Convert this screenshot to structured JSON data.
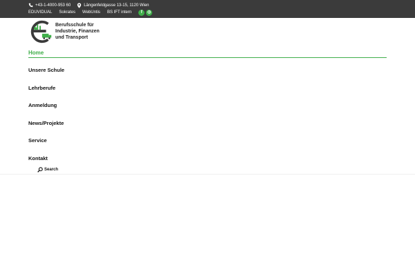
{
  "topbar": {
    "phone": "+43-1-4000-953 60",
    "address": "Längenfeldgasse 13-15, 1120 Wien",
    "links": [
      "EDUVIDUAL",
      "Sokrates",
      "WebUntis",
      "BS IFT intern"
    ],
    "social": [
      {
        "icon": "facebook-icon",
        "glyph": "f"
      },
      {
        "icon": "instagram-icon",
        "glyph": "◎"
      }
    ]
  },
  "brand": {
    "line1": "Berufsschule für",
    "line2": "Industrie, Finanzen",
    "line3": "und Transport"
  },
  "nav": {
    "home": "Home",
    "items": [
      "Unsere Schule",
      "Lehrberufe",
      "Anmeldung",
      "News/Projekte",
      "Service",
      "Kontakt"
    ]
  },
  "search": {
    "label": "Search"
  },
  "colors": {
    "accent": "#3fae49",
    "topbar_bg": "#3b3b3b"
  }
}
